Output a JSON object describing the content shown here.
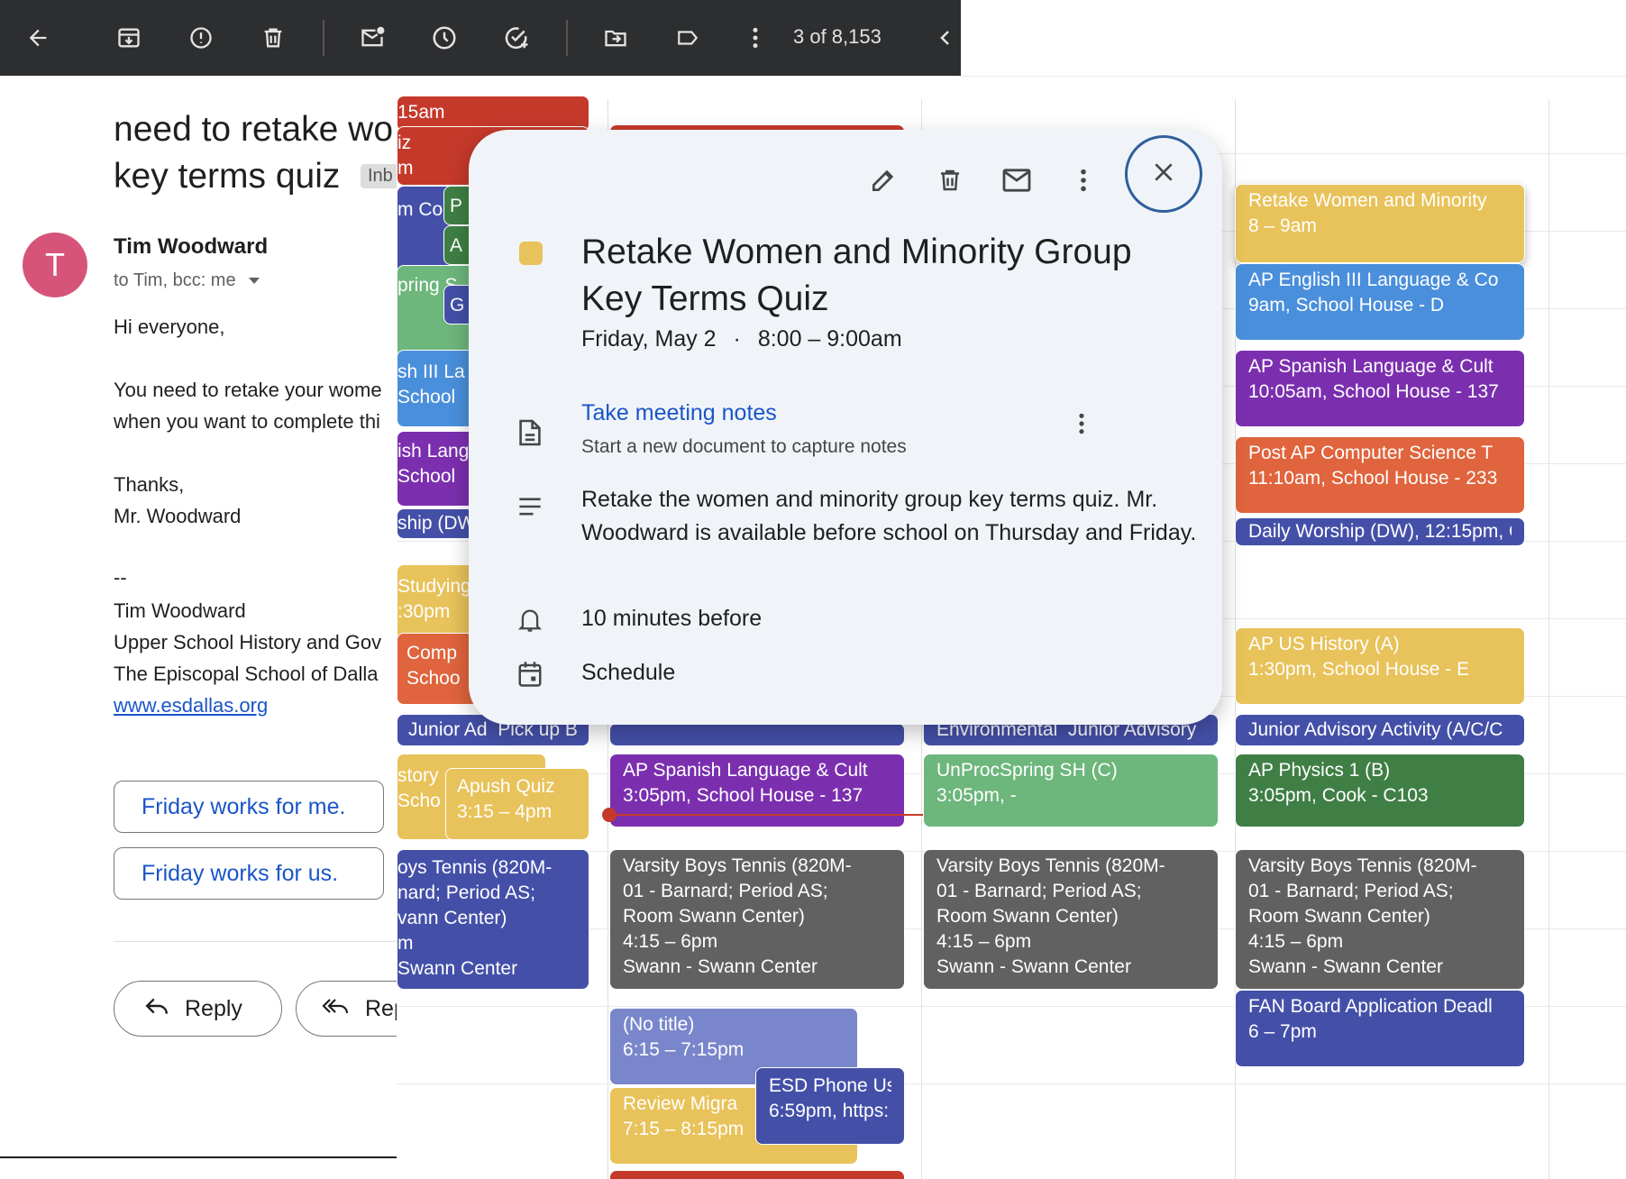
{
  "toolbar": {
    "pager": "3 of 8,153",
    "icons": [
      "back-arrow-icon",
      "archive-icon",
      "report-spam-icon",
      "delete-icon",
      "mark-unread-icon",
      "snooze-icon",
      "add-task-icon",
      "move-to-icon",
      "label-icon",
      "more-icon",
      "newer-icon"
    ]
  },
  "email": {
    "subject": "need to retake women and minority group key terms quiz",
    "subject_line1": "need to retake wo",
    "subject_line2": "key terms quiz",
    "inbox_chip": "Inb",
    "avatar_letter": "T",
    "sender": "Tim Woodward",
    "recipients": "to Tim, bcc: me",
    "greeting": "Hi everyone,",
    "body_line1": "You need to retake your wome",
    "body_line2": "when you want to complete thi",
    "thanks": "Thanks,",
    "signoff": "Mr. Woodward",
    "sig_dash": "--",
    "sig_name": "Tim Woodward",
    "sig_title": "Upper School History and Gov",
    "sig_school": "The Episcopal School of Dalla",
    "sig_link": "www.esdallas.org",
    "smart_reply_1": "Friday works for me.",
    "smart_reply_2": "Friday works for us.",
    "reply_label": "Reply",
    "reply_all_label": "Rep"
  },
  "calendar": {
    "col1": {
      "ev_a": "15am",
      "ev_b1": "iz",
      "ev_b2": "m",
      "ev_c": "m Co",
      "ev_c2": "P",
      "ev_c3": "A",
      "ev_d": "pring S",
      "ev_d2": "G",
      "ev_e1": "sh III La",
      "ev_e2": "School",
      "ev_f1": "ish Lang",
      "ev_f2": "School",
      "ev_g": "ship (DW",
      "ev_h1": "Studying",
      "ev_h2": ":30pm",
      "ev_i1": "Comp",
      "ev_i2": "Schoo",
      "ev_j1": "Junior Ad",
      "ev_j2": "Pick up B",
      "ev_k1": "story",
      "ev_k2": "Scho",
      "apush_title": "Apush Quiz",
      "apush_time": "3:15 – 4pm",
      "tennis_1": "oys Tennis (820M-",
      "tennis_2": "nard; Period AS;",
      "tennis_3": "vann Center)",
      "tennis_4": "m",
      "tennis_5": "Swann Center"
    },
    "col2": {
      "spanish_title": "AP Spanish Language & Cult",
      "spanish_time": "3:05pm, School House - 137",
      "tennis_1": "Varsity Boys Tennis (820M-",
      "tennis_2": "01 - Barnard; Period AS;",
      "tennis_3": "Room Swann Center)",
      "tennis_4": "4:15 – 6pm",
      "tennis_5": "Swann - Swann Center",
      "notitle_title": "(No title)",
      "notitle_time": "6:15 – 7:15pm",
      "phone_title": "ESD Phone Us",
      "phone_time": "6:59pm, https:",
      "review_title": "Review Migra",
      "review_time": "7:15 – 8:15pm"
    },
    "col3": {
      "env": "Environmental",
      "junior": "Junior Advisory",
      "unproc_title": "UnProcSpring SH (C)",
      "unproc_time": "3:05pm, -",
      "tennis_1": "Varsity Boys Tennis (820M-",
      "tennis_2": "01 - Barnard; Period AS;",
      "tennis_3": "Room Swann Center)",
      "tennis_4": "4:15 – 6pm",
      "tennis_5": "Swann - Swann Center"
    },
    "col4": {
      "retake_title": "Retake Women and Minority",
      "retake_time": "8 – 9am",
      "english_title": "AP English III Language & Co",
      "english_time": "9am, School House - D",
      "spanish_title": "AP Spanish Language & Cult",
      "spanish_time": "10:05am, School House - 137",
      "cs_title": "Post AP Computer Science T",
      "cs_time": "11:10am, School House - 233",
      "worship": "Daily Worship (DW), 12:15pm, C",
      "ush_title": "AP US History (A)",
      "ush_time": "1:30pm, School House - E",
      "junior": "Junior Advisory Activity (A/C/C",
      "physics_title": "AP Physics 1 (B)",
      "physics_time": "3:05pm, Cook - C103",
      "tennis_1": "Varsity Boys Tennis (820M-",
      "tennis_2": "01 - Barnard; Period AS;",
      "tennis_3": "Room Swann Center)",
      "tennis_4": "4:15 – 6pm",
      "tennis_5": "Swann - Swann Center",
      "fan_title": "FAN Board Application Deadl",
      "fan_time": "6 – 7pm"
    }
  },
  "popup": {
    "icons": [
      "edit-icon",
      "delete-icon",
      "email-guests-icon",
      "more-options-icon",
      "close-icon"
    ],
    "title": "Retake Women and Minority Group Key Terms Quiz",
    "date": "Friday, May 2",
    "separator": "·",
    "time": "8:00 – 9:00am",
    "notes_title": "Take meeting notes",
    "notes_sub": "Start a new document to capture notes",
    "description": "Retake the women and minority group key terms quiz. Mr. Woodward is available before school on Thursday and Friday.",
    "reminder": "10 minutes before",
    "calendar_name": "Schedule",
    "event_color": "#e8c25a"
  },
  "colors": {
    "red": "#c5392b",
    "green": "#3f7f45",
    "blue_dark": "#4450a8",
    "blue": "#4a8fdc",
    "purple": "#7b2faf",
    "yellow": "#e8c25a",
    "orange": "#e0643d",
    "sage": "#6db67c",
    "gray": "#616161",
    "lavender": "#7986cb",
    "link": "#1a55c8"
  }
}
